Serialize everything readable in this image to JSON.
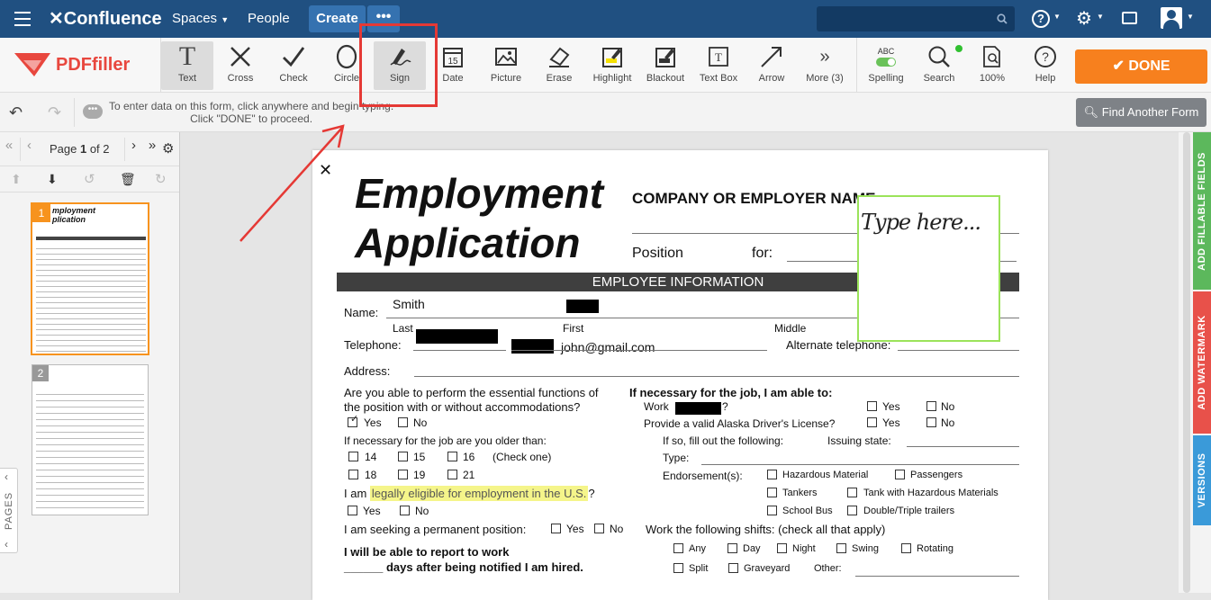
{
  "nav": {
    "logo": "Confluence",
    "spaces": "Spaces",
    "people": "People",
    "create": "Create",
    "more": "•••"
  },
  "toolbar": {
    "brand": "PDFfiller",
    "tools": [
      "Text",
      "Cross",
      "Check",
      "Circle",
      "Sign",
      "Date",
      "Picture",
      "Erase",
      "Highlight",
      "Blackout",
      "Text Box",
      "Arrow",
      "More (3)",
      "Spelling",
      "Search",
      "100%",
      "Help"
    ],
    "spelling_badge": "ABC",
    "done": "DONE"
  },
  "infobar": {
    "hint1": "To enter data on this form, click anywhere and begin typing.",
    "hint2": "Click \"DONE\" to proceed.",
    "find_another": "Find Another Form"
  },
  "pager": {
    "page_label_pre": "Page ",
    "page_current": "1",
    "page_label_mid": " of 2"
  },
  "thumbs": {
    "page1": "1",
    "page2": "2",
    "pages_tab": "PAGES"
  },
  "rail": {
    "add_fields": "ADD FILLABLE FIELDS",
    "watermark": "ADD WATERMARK",
    "versions": "VERSIONS"
  },
  "doc": {
    "title1": "Employment",
    "title2": "Application",
    "company": "COMPANY OR EMPLOYER NAME",
    "position": "Position",
    "for": "for:",
    "section": "EMPLOYEE INFORMATION",
    "name": "Name:",
    "name_value": "Smith",
    "last": "Last",
    "first": "First",
    "middle": "Middle",
    "telephone": "Telephone:",
    "email": "john@gmail.com",
    "alt_phone": "Alternate telephone:",
    "address": "Address:",
    "q1a": "Are you able to perform the essential functions of",
    "q1b": "the position with or without accommodations?",
    "yes": "Yes",
    "no": "No",
    "q2": "If necessary for the job are you older than:",
    "ages": [
      "14",
      "15",
      "16",
      "18",
      "19",
      "21"
    ],
    "check_one": "(Check one)",
    "q3_pre": "I am ",
    "q3_hl": "legally eligible for employment in the U.S.",
    "q3_post": "?",
    "q4": "I am seeking a permanent position:",
    "q5a": "I will be able to report to work",
    "q5b": "______ days after being notified I am hired.",
    "r1": "If necessary for the job, I am able to:",
    "work": "Work",
    "work_q": "?",
    "drivers": "Provide a valid Alaska Driver's License?",
    "if_so": "If so, fill out the following:",
    "issuing": "Issuing state:",
    "type": "Type:",
    "endorse": "Endorsement(s):",
    "hazmat": "Hazardous Material",
    "passengers": "Passengers",
    "tankers": "Tankers",
    "tank_haz": "Tank with Hazardous Materials",
    "school_bus": "School Bus",
    "double": "Double/Triple trailers",
    "shifts": "Work the following shifts: (check all that apply)",
    "shift_list": [
      "Any",
      "Day",
      "Night",
      "Swing",
      "Rotating",
      "Split",
      "Graveyard"
    ],
    "other": "Other:",
    "sig_placeholder": "Type here..."
  },
  "colors": {
    "nav": "#205081",
    "done": "#f7801e",
    "highlight": "#f5f58a",
    "sig_border": "#9be35a",
    "annot": "#e53935"
  }
}
